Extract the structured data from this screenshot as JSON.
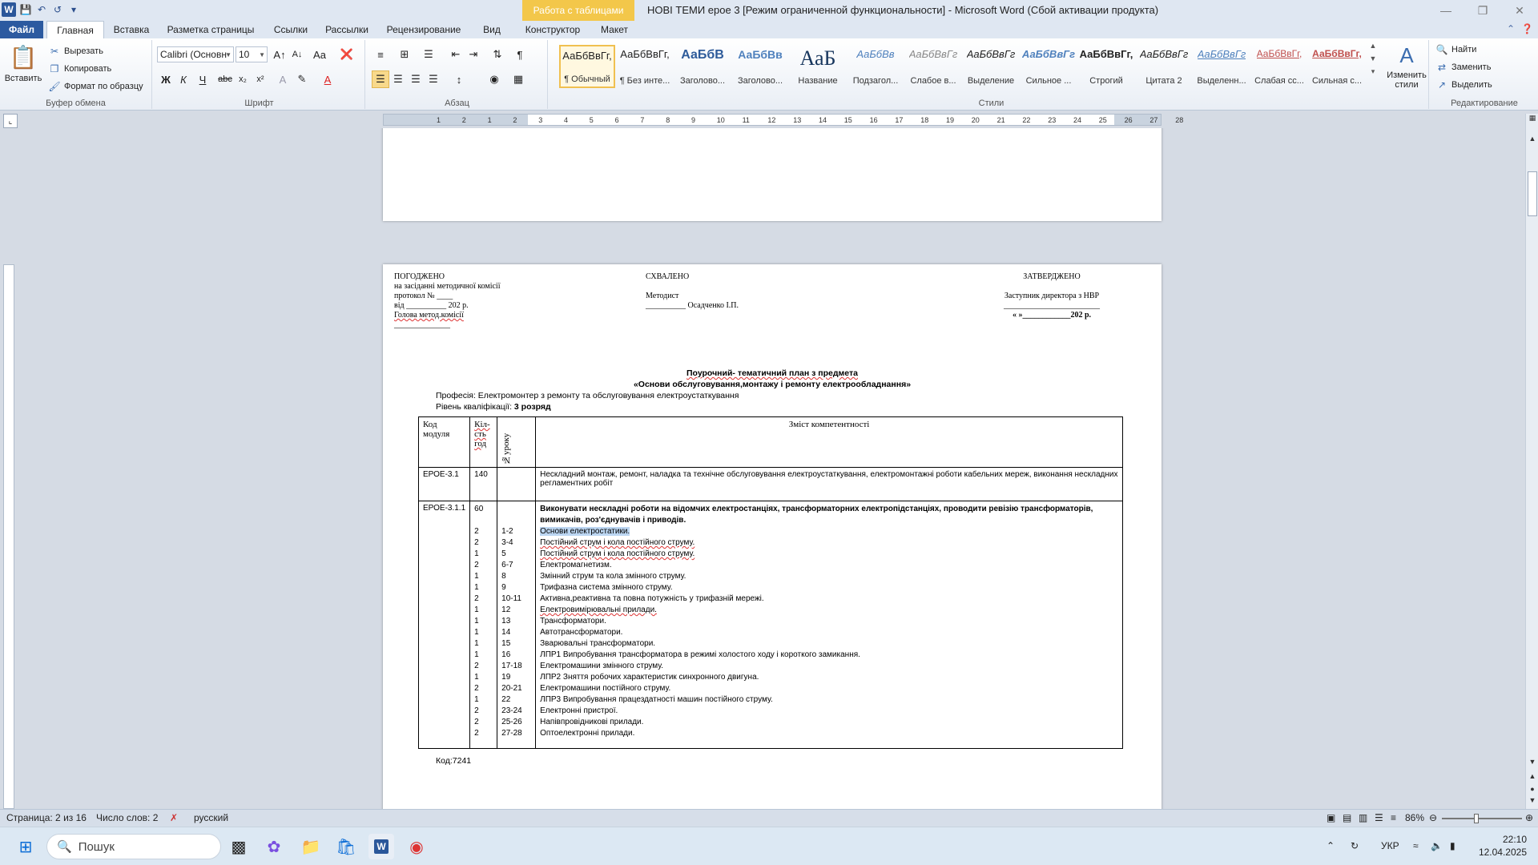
{
  "titlebar": {
    "contextual_tab": "Работа с таблицами",
    "title": "НОВІ ТЕМИ ерое 3 [Режим ограниченной функциональности]  -  Microsoft Word (Сбой активации продукта)"
  },
  "tabs": [
    "Файл",
    "Главная",
    "Вставка",
    "Разметка страницы",
    "Ссылки",
    "Рассылки",
    "Рецензирование",
    "Вид",
    "Конструктор",
    "Макет"
  ],
  "ribbon": {
    "clipboard": {
      "paste": "Вставить",
      "cut": "Вырезать",
      "copy": "Копировать",
      "format_painter": "Формат по образцу",
      "label": "Буфер обмена"
    },
    "font": {
      "name": "Calibri (Основн",
      "size": "10",
      "label": "Шрифт"
    },
    "paragraph": {
      "label": "Абзац"
    },
    "styles": {
      "label": "Стили",
      "items": [
        {
          "sample": "АаБбВвГг,",
          "name": "¶ Обычный"
        },
        {
          "sample": "АаБбВвГг,",
          "name": "¶ Без инте..."
        },
        {
          "sample": "АаБбВ",
          "name": "Заголово..."
        },
        {
          "sample": "АаБбВв",
          "name": "Заголово..."
        },
        {
          "sample": "АаБ",
          "name": "Название"
        },
        {
          "sample": "АаБбВв",
          "name": "Подзагол..."
        },
        {
          "sample": "АаБбВвГг",
          "name": "Слабое в..."
        },
        {
          "sample": "АаБбВвГг",
          "name": "Выделение"
        },
        {
          "sample": "АаБбВвГг",
          "name": "Сильное ..."
        },
        {
          "sample": "АаБбВвГг,",
          "name": "Строгий"
        },
        {
          "sample": "АаБбВвГг",
          "name": "Цитата 2"
        },
        {
          "sample": "АаБбВвГг",
          "name": "Выделенн..."
        },
        {
          "sample": "АаБбВвГг,",
          "name": "Слабая сс..."
        },
        {
          "sample": "АаБбВвГг,",
          "name": "Сильная с..."
        }
      ],
      "change_styles": "Изменить стили"
    },
    "editing": {
      "find": "Найти",
      "replace": "Заменить",
      "select": "Выделить",
      "label": "Редактирование"
    }
  },
  "document": {
    "approved_block": {
      "title": "ПОГОДЖЕНО",
      "line1": "на засіданні методичної комісії",
      "line2": "протокол № ____",
      "line3": "від __________ 202  р.",
      "line4": "Голова  метод.комісії",
      "line5": "______________"
    },
    "praised_block": {
      "title": "СХВАЛЕНО",
      "line1": "Методист",
      "line2": "__________  Осадченко  І.П."
    },
    "confirmed_block": {
      "title": "ЗАТВЕРДЖЕНО",
      "line1": "Заступник  директора  з НВР",
      "line2": "________________________",
      "line3": "«   »____________202  р."
    },
    "plan_title": "Поурочний- тематичний план з предмета",
    "plan_subject": "«Основи обслуговування,монтажу і ремонту електрообладнання»",
    "profession": "Професія: Електромонтер з ремонту та обслуговування електроустаткування",
    "qualification_label": "Рівень кваліфікації:",
    "qualification_value": "3 розряд",
    "table": {
      "headers": {
        "module": "Код модуля",
        "hours": "Кіл-сть год",
        "lesson": "№уроку",
        "content": "Зміст компетентності"
      },
      "row1": {
        "module": "ЕРОЕ-3.1",
        "hours": "140",
        "content": "Нескладний монтаж, ремонт, наладка та технічне обслуговування електроустаткування, електромонтажні роботи кабельних мереж, виконання нескладних регламентних робіт"
      },
      "row2": {
        "module": "ЕРОЕ-3.1.1",
        "hours": "60",
        "content": "Виконувати нескладні роботи на відомчих електростанціях, трансформаторних електропідстанціях, проводити ревізію трансформаторів, вимикачів, роз'єднувачів і приводів.",
        "lessons": [
          {
            "h": "2",
            "n": "1-2",
            "t": "Основи електростатики."
          },
          {
            "h": "2",
            "n": "3-4",
            "t": "Постійний струм і кола постійного струму."
          },
          {
            "h": "1",
            "n": "5",
            "t": "Постійний струм і кола постійного струму."
          },
          {
            "h": "2",
            "n": "6-7",
            "t": "Електромагнетизм."
          },
          {
            "h": "1",
            "n": "8",
            "t": "Змінний струм та кола змінного струму."
          },
          {
            "h": "1",
            "n": "9",
            "t": "Трифазна система змінного струму."
          },
          {
            "h": "2",
            "n": "10-11",
            "t": "Активна,реактивна та повна потужність у трифазній мережі."
          },
          {
            "h": "1",
            "n": "12",
            "t": "Електровимірювальні прилади."
          },
          {
            "h": "1",
            "n": "13",
            "t": "Трансформатори."
          },
          {
            "h": "1",
            "n": "14",
            "t": "Автотрансформатори."
          },
          {
            "h": "1",
            "n": "15",
            "t": "Зварювальні трансформатори."
          },
          {
            "h": "1",
            "n": "16",
            "t": "ЛПР1 Випробування трансформатора в режимі холостого ходу і короткого замикання."
          },
          {
            "h": "2",
            "n": "17-18",
            "t": "Електромашини змінного струму."
          },
          {
            "h": "1",
            "n": "19",
            "t": "ЛПР2 Зняття робочих характеристик синхронного двигуна."
          },
          {
            "h": "2",
            "n": "20-21",
            "t": "Електромашини постійного струму."
          },
          {
            "h": "1",
            "n": "22",
            "t": "ЛПР3 Випробування працездатності машин постійного струму."
          },
          {
            "h": "2",
            "n": "23-24",
            "t": "Електронні  пристрої."
          },
          {
            "h": "2",
            "n": "25-26",
            "t": "Напівпровідникові прилади."
          },
          {
            "h": "2",
            "n": "27-28",
            "t": "Оптоелектронні прилади."
          }
        ]
      }
    },
    "code_footer": "Код:7241"
  },
  "statusbar": {
    "page": "Страница: 2 из 16",
    "words": "Число слов: 2",
    "language": "русский",
    "zoom": "86%",
    "zoom_level": 0.43
  },
  "taskbar": {
    "search": "Пошук",
    "lang": "УКР",
    "time": "22:10",
    "date": "12.04.2025"
  },
  "ruler_ticks": [
    "1",
    "2",
    "1",
    "2",
    "3",
    "4",
    "5",
    "6",
    "7",
    "8",
    "9",
    "10",
    "11",
    "12",
    "13",
    "14",
    "15",
    "16",
    "17",
    "18",
    "19",
    "20",
    "21",
    "22",
    "23",
    "24",
    "25",
    "26",
    "27",
    "28"
  ]
}
